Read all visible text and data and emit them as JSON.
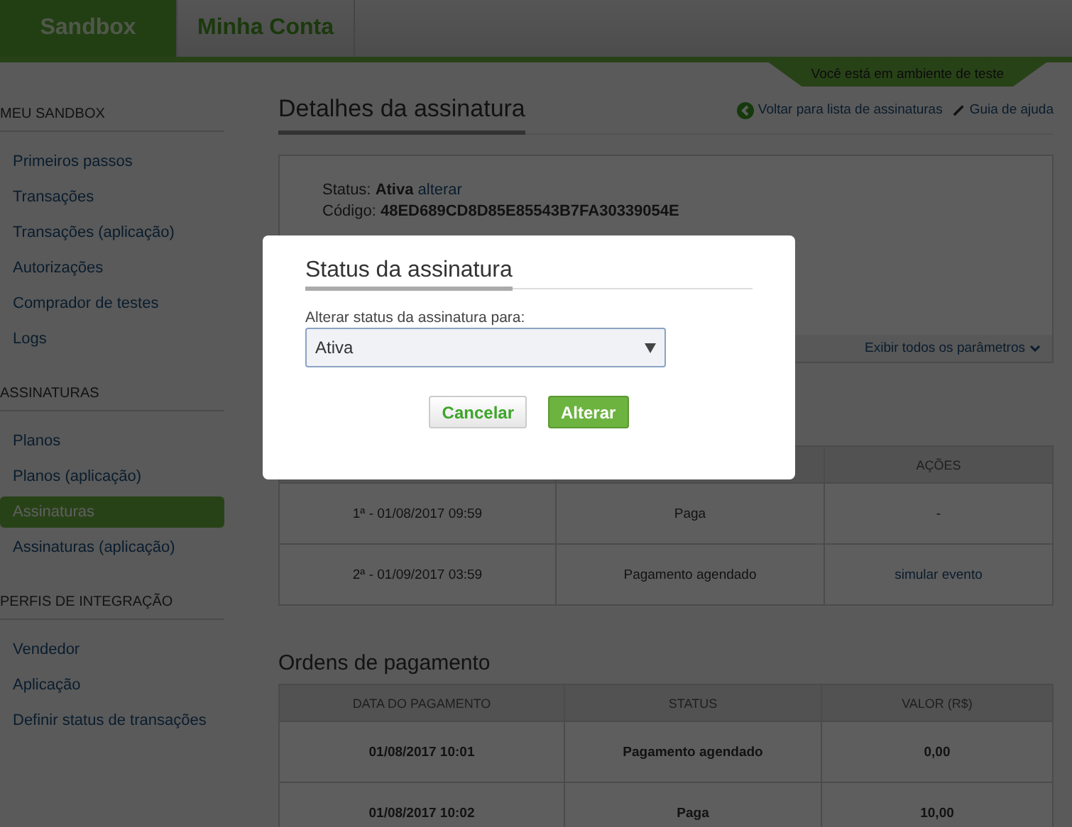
{
  "top_nav": {
    "tabs": [
      {
        "label": "Sandbox",
        "selected": true
      },
      {
        "label": "Minha Conta",
        "selected": false
      }
    ]
  },
  "env_banner": "Você está em ambiente de teste",
  "sidebar": {
    "sections": [
      {
        "title": "MEU SANDBOX",
        "items": [
          {
            "label": "Primeiros passos",
            "selected": false
          },
          {
            "label": "Transações",
            "selected": false
          },
          {
            "label": "Transações (aplicação)",
            "selected": false
          },
          {
            "label": "Autorizações",
            "selected": false
          },
          {
            "label": "Comprador de testes",
            "selected": false
          },
          {
            "label": "Logs",
            "selected": false
          }
        ]
      },
      {
        "title": "ASSINATURAS",
        "items": [
          {
            "label": "Planos",
            "selected": false
          },
          {
            "label": "Planos (aplicação)",
            "selected": false
          },
          {
            "label": "Assinaturas",
            "selected": true
          },
          {
            "label": "Assinaturas (aplicação)",
            "selected": false
          }
        ]
      },
      {
        "title": "PERFIS DE INTEGRAÇÃO",
        "items": [
          {
            "label": "Vendedor",
            "selected": false
          },
          {
            "label": "Aplicação",
            "selected": false
          },
          {
            "label": "Definir status de transações",
            "selected": false
          }
        ]
      }
    ]
  },
  "main": {
    "title": "Detalhes da assinatura",
    "back_link": "Voltar para lista de assinaturas",
    "help_link": "Guia de ajuda",
    "details": {
      "status_label": "Status:",
      "status": "Ativa",
      "change_link": "alterar",
      "code_label": "Código:",
      "code": "48ED689CD8D85E85543B7FA30339054E",
      "show_all_link": "Exibir todos os parâmetros"
    },
    "charges_table": {
      "columns": [
        "",
        "",
        "AÇÕES"
      ],
      "rows": [
        {
          "cells": [
            "1ª - 01/08/2017 09:59",
            "Paga",
            "-"
          ],
          "action_link": false
        },
        {
          "cells": [
            "2ª - 01/09/2017 03:59",
            "Pagamento agendado",
            "simular evento"
          ],
          "action_link": true
        }
      ]
    },
    "orders_title": "Ordens de pagamento",
    "orders_table": {
      "columns": [
        "DATA DO PAGAMENTO",
        "STATUS",
        "VALOR (R$)"
      ],
      "rows": [
        {
          "cells": [
            "01/08/2017 10:01",
            "Pagamento agendado",
            "0,00"
          ]
        },
        {
          "cells": [
            "01/08/2017 10:02",
            "Paga",
            "10,00"
          ]
        }
      ]
    }
  },
  "modal": {
    "title": "Status da assinatura",
    "field_label": "Alterar status da assinatura para:",
    "select_value": "Ativa",
    "cancel_button": "Cancelar",
    "confirm_button": "Alterar"
  }
}
